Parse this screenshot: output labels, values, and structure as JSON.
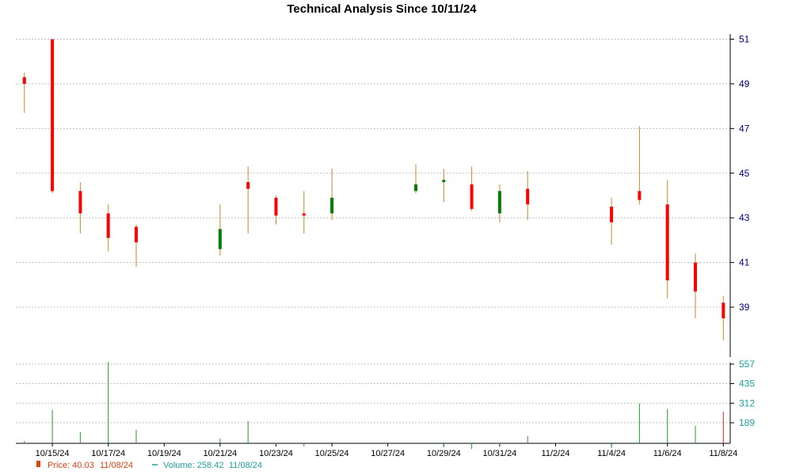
{
  "chart_data": {
    "type": "candlestick",
    "title": "Technical Analysis Since 10/11/24",
    "price_axis": {
      "ylim": [
        37.0,
        51.3
      ],
      "ticks": [
        39,
        41,
        43,
        45,
        47,
        49,
        51
      ],
      "position": "right"
    },
    "volume_axis": {
      "ylim": [
        0,
        600
      ],
      "ticks": [
        189,
        312,
        435,
        557
      ],
      "position": "right"
    },
    "x_tick_labels": [
      "10/15/24",
      "10/17/24",
      "10/19/24",
      "10/21/24",
      "10/23/24",
      "10/25/24",
      "10/27/24",
      "10/29/24",
      "10/31/24",
      "11/2/24",
      "11/4/24",
      "11/6/24",
      "11/8/24"
    ],
    "x_tick_days": [
      4,
      6,
      8,
      10,
      12,
      14,
      16,
      18,
      20,
      22,
      24,
      26,
      28
    ],
    "grid": true,
    "candles": [
      {
        "day": 3,
        "open": 49.3,
        "high": 49.5,
        "low": 47.7,
        "close": 49.0
      },
      {
        "day": 4,
        "open": 51.0,
        "high": 51.0,
        "low": 44.1,
        "close": 44.2
      },
      {
        "day": 5,
        "open": 44.2,
        "high": 44.6,
        "low": 42.3,
        "close": 43.2
      },
      {
        "day": 6,
        "open": 43.2,
        "high": 43.6,
        "low": 41.5,
        "close": 42.1
      },
      {
        "day": 7,
        "open": 42.6,
        "high": 42.7,
        "low": 40.8,
        "close": 41.9
      },
      {
        "day": 10,
        "open": 41.6,
        "high": 43.6,
        "low": 41.3,
        "close": 42.5
      },
      {
        "day": 11,
        "open": 44.6,
        "high": 45.3,
        "low": 42.3,
        "close": 44.3
      },
      {
        "day": 12,
        "open": 43.9,
        "high": 44.0,
        "low": 42.7,
        "close": 43.1
      },
      {
        "day": 13,
        "open": 43.2,
        "high": 44.2,
        "low": 42.3,
        "close": 43.1
      },
      {
        "day": 14,
        "open": 43.2,
        "high": 45.2,
        "low": 42.9,
        "close": 43.9
      },
      {
        "day": 17,
        "open": 44.2,
        "high": 45.4,
        "low": 44.1,
        "close": 44.5
      },
      {
        "day": 18,
        "open": 44.6,
        "high": 45.2,
        "low": 43.7,
        "close": 44.7
      },
      {
        "day": 19,
        "open": 44.5,
        "high": 45.3,
        "low": 43.3,
        "close": 43.4
      },
      {
        "day": 20,
        "open": 43.2,
        "high": 44.5,
        "low": 42.8,
        "close": 44.2
      },
      {
        "day": 21,
        "open": 44.3,
        "high": 45.1,
        "low": 42.9,
        "close": 43.6
      },
      {
        "day": 24,
        "open": 43.5,
        "high": 43.9,
        "low": 41.8,
        "close": 42.8
      },
      {
        "day": 25,
        "open": 44.2,
        "high": 47.1,
        "low": 43.6,
        "close": 43.8
      },
      {
        "day": 26,
        "open": 43.6,
        "high": 44.7,
        "low": 39.4,
        "close": 40.2
      },
      {
        "day": 27,
        "open": 41.0,
        "high": 41.4,
        "low": 38.5,
        "close": 39.7
      },
      {
        "day": 28,
        "open": 39.2,
        "high": 39.5,
        "low": 37.5,
        "close": 38.5
      }
    ],
    "volume": [
      {
        "day": 3,
        "value": 75
      },
      {
        "day": 4,
        "value": 270
      },
      {
        "day": 5,
        "value": 130
      },
      {
        "day": 6,
        "value": 570
      },
      {
        "day": 7,
        "value": 145
      },
      {
        "day": 10,
        "value": 90
      },
      {
        "day": 11,
        "value": 200
      },
      {
        "day": 12,
        "value": 55
      },
      {
        "day": 13,
        "value": 40
      },
      {
        "day": 14,
        "value": 65
      },
      {
        "day": 17,
        "value": 60
      },
      {
        "day": 18,
        "value": 35
      },
      {
        "day": 19,
        "value": 25
      },
      {
        "day": 20,
        "value": 50
      },
      {
        "day": 21,
        "value": 105
      },
      {
        "day": 24,
        "value": 30
      },
      {
        "day": 25,
        "value": 310
      },
      {
        "day": 26,
        "value": 275
      },
      {
        "day": 27,
        "value": 170
      },
      {
        "day": 28,
        "value": 258.42,
        "color": "#b03020"
      }
    ],
    "colors": {
      "up": "#008000",
      "down": "#ff0000",
      "wick": "#c88a2a",
      "volume": "#20a020",
      "grid": "#c0c0c0"
    },
    "legend": {
      "price": {
        "label": "Price: 40.03",
        "date": "11/08/24",
        "color": "#e04010"
      },
      "volume": {
        "label": "Volume: 258.42",
        "date": "11/08/24",
        "color": "#20a0a0"
      }
    }
  }
}
